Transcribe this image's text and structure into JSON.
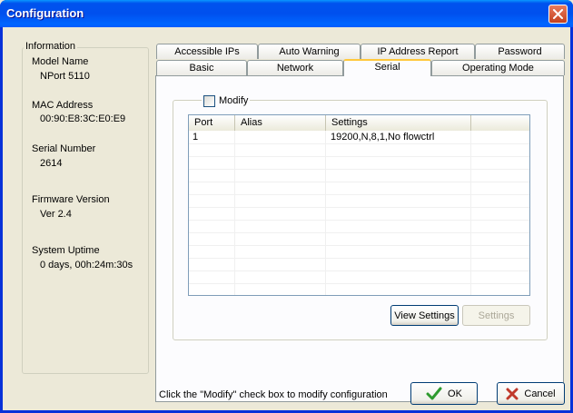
{
  "window": {
    "title": "Configuration"
  },
  "info": {
    "legend": "Information",
    "model_name_label": "Model Name",
    "model_name": "NPort 5110",
    "mac_label": "MAC Address",
    "mac": "00:90:E8:3C:E0:E9",
    "serial_label": "Serial Number",
    "serial": "2614",
    "firmware_label": "Firmware Version",
    "firmware": "Ver 2.4",
    "uptime_label": "System Uptime",
    "uptime": "0 days, 00h:24m:30s"
  },
  "tabs": {
    "row1": [
      "Accessible IPs",
      "Auto Warning",
      "IP Address Report",
      "Password"
    ],
    "row2": [
      "Basic",
      "Network",
      "Serial",
      "Operating Mode"
    ],
    "active": "Serial"
  },
  "serial_panel": {
    "modify_label": "Modify",
    "modify_checked": false,
    "columns": [
      "Port",
      "Alias",
      "Settings",
      ""
    ],
    "rows": [
      {
        "port": "1",
        "alias": "",
        "settings": "19200,N,8,1,No flowctrl"
      }
    ],
    "view_settings_label": "View Settings",
    "settings_label": "Settings"
  },
  "footer": {
    "status": "Click the \"Modify\" check box to modify configuration",
    "ok_label": "OK",
    "cancel_label": "Cancel"
  },
  "colors": {
    "titlebar": "#0053ee",
    "ok_icon": "#2e9a2e",
    "cancel_icon": "#c0392b"
  }
}
